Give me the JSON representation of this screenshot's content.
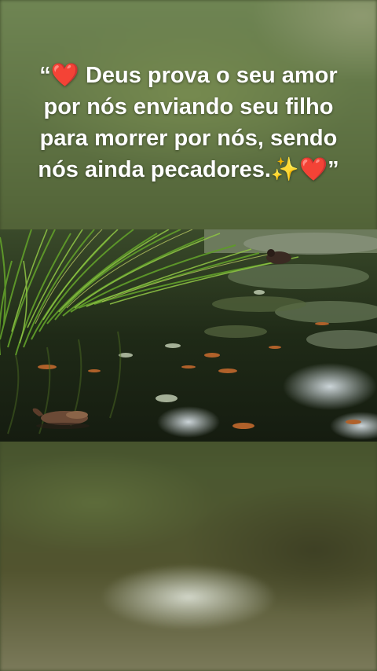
{
  "quote": {
    "text": "“❤️ Deus prova o seu amor por nós enviando seu filho para morrer por nós, sendo nós ainda pecadores.✨❤️”"
  },
  "photo": {
    "subject": "pond-with-grass-and-ducks"
  },
  "colors": {
    "text": "#ffffff",
    "background_top": "#6f8553",
    "background_bottom": "#52542f"
  }
}
